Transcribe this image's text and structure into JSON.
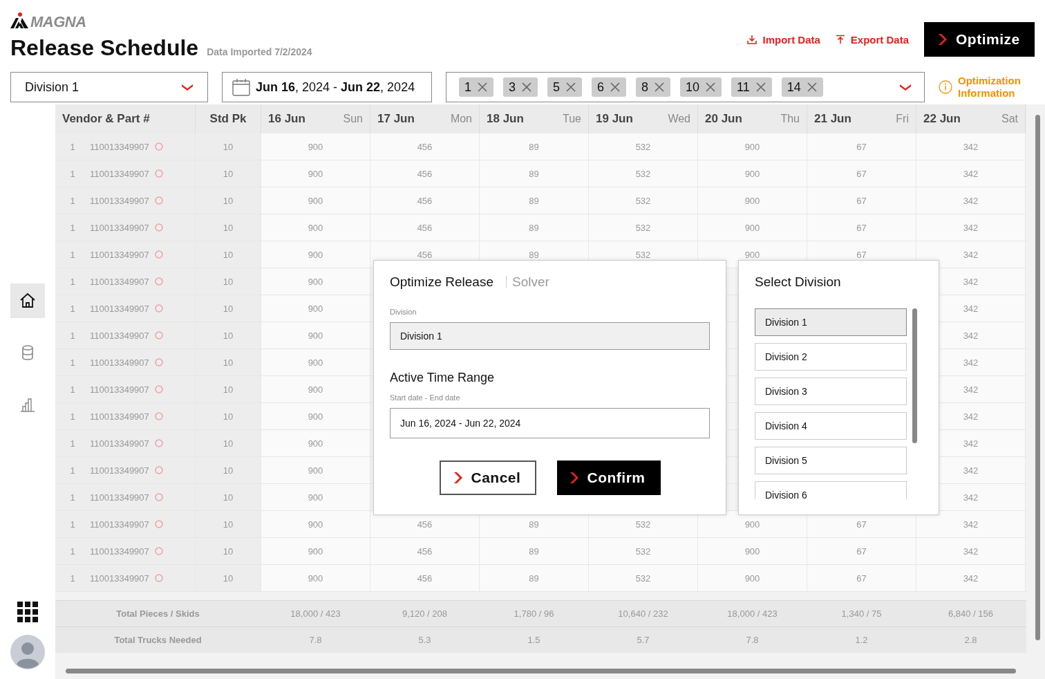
{
  "header": {
    "brand": "MAGNA",
    "title": "Release Schedule",
    "subtitle": "Data Imported 7/2/2024",
    "actions": [
      {
        "kind": "import",
        "label": "Import Data"
      },
      {
        "kind": "export",
        "label": "Export Data"
      }
    ],
    "primary_button": "Optimize"
  },
  "filters": {
    "division": "Division 1",
    "date_range": "**Jun 16**, 2024 - **Jun 22**, 2024",
    "chips": [
      "1",
      "3",
      "5",
      "6",
      "8",
      "10",
      "11",
      "14"
    ],
    "info": "Optimization Information"
  },
  "sidebar": {
    "items": [
      {
        "kind": "home",
        "selected": true
      },
      {
        "kind": "database",
        "selected": false
      },
      {
        "kind": "chart",
        "selected": false
      }
    ]
  },
  "table": {
    "columns": [
      {
        "label": "Vendor & Part #"
      },
      {
        "label": "Std Pk"
      },
      {
        "label": "16 Jun",
        "day": "Sun"
      },
      {
        "label": "17 Jun",
        "day": "Mon"
      },
      {
        "label": "18 Jun",
        "day": "Tue"
      },
      {
        "label": "19 Jun",
        "day": "Wed"
      },
      {
        "label": "20 Jun",
        "day": "Thu"
      },
      {
        "label": "21 Jun",
        "day": "Fri"
      },
      {
        "label": "22 Jun",
        "day": "Sat"
      }
    ],
    "rows": [
      {
        "vendor": "1",
        "part": "110013349907",
        "std_pk": "10",
        "values": [
          "900",
          "456",
          "89",
          "532",
          "900",
          "67",
          "342"
        ]
      },
      {
        "vendor": "1",
        "part": "110013349907",
        "std_pk": "10",
        "values": [
          "900",
          "456",
          "89",
          "532",
          "900",
          "67",
          "342"
        ]
      },
      {
        "vendor": "1",
        "part": "110013349907",
        "std_pk": "10",
        "values": [
          "900",
          "456",
          "89",
          "532",
          "900",
          "67",
          "342"
        ]
      },
      {
        "vendor": "1",
        "part": "110013349907",
        "std_pk": "10",
        "values": [
          "900",
          "456",
          "89",
          "532",
          "900",
          "67",
          "342"
        ]
      },
      {
        "vendor": "1",
        "part": "110013349907",
        "std_pk": "10",
        "values": [
          "900",
          "456",
          "89",
          "532",
          "900",
          "67",
          "342"
        ]
      },
      {
        "kind": "partial",
        "vendor": "1",
        "part": "110013349907",
        "std_pk": "10",
        "values": [
          "900",
          "342"
        ]
      },
      {
        "kind": "partial",
        "vendor": "1",
        "part": "110013349907",
        "std_pk": "10",
        "values": [
          "900",
          "342"
        ]
      },
      {
        "kind": "partial",
        "vendor": "1",
        "part": "110013349907",
        "std_pk": "10",
        "values": [
          "900",
          "342"
        ]
      },
      {
        "kind": "partial",
        "vendor": "1",
        "part": "110013349907",
        "std_pk": "10",
        "values": [
          "900",
          "342"
        ]
      },
      {
        "kind": "partial",
        "vendor": "1",
        "part": "110013349907",
        "std_pk": "10",
        "values": [
          "900",
          "342"
        ]
      },
      {
        "kind": "partial",
        "vendor": "1",
        "part": "110013349907",
        "std_pk": "10",
        "values": [
          "900",
          "342"
        ]
      },
      {
        "kind": "partial",
        "vendor": "1",
        "part": "110013349907",
        "std_pk": "10",
        "values": [
          "900",
          "342"
        ]
      },
      {
        "kind": "partial",
        "vendor": "1",
        "part": "110013349907",
        "std_pk": "10",
        "values": [
          "900",
          "342"
        ]
      },
      {
        "kind": "partial",
        "vendor": "1",
        "part": "110013349907",
        "std_pk": "10",
        "values": [
          "900",
          "342"
        ]
      },
      {
        "vendor": "1",
        "part": "110013349907",
        "std_pk": "10",
        "values": [
          "900",
          "456",
          "89",
          "532",
          "900",
          "67",
          "342"
        ]
      },
      {
        "vendor": "1",
        "part": "110013349907",
        "std_pk": "10",
        "values": [
          "900",
          "456",
          "89",
          "532",
          "900",
          "67",
          "342"
        ]
      },
      {
        "vendor": "1",
        "part": "110013349907",
        "std_pk": "10",
        "values": [
          "900",
          "456",
          "89",
          "532",
          "900",
          "67",
          "342"
        ]
      }
    ],
    "totals": [
      {
        "label": "Total Pieces / Skids",
        "values": [
          "18,000 / 423",
          "9,120 / 208",
          "1,780 / 96",
          "10,640 / 232",
          "18,000 / 423",
          "1,340 / 75",
          "6,840 / 156"
        ]
      },
      {
        "label": "Total Trucks Needed",
        "values": [
          "7.8",
          "5.3",
          "1.5",
          "5.7",
          "7.8",
          "1.2",
          "2.8"
        ]
      }
    ]
  },
  "optimize_dialog": {
    "title": "Optimize Release",
    "subtitle": "Solver",
    "division_label": "Division",
    "division_value": "Division 1",
    "section_title": "Active Time Range",
    "range_label": "Start date - End date",
    "range_value": "Jun 16, 2024 - Jun 22, 2024",
    "buttons": [
      {
        "kind": "secondary",
        "label": "Cancel"
      },
      {
        "kind": "primary",
        "label": "Confirm"
      }
    ]
  },
  "division_dialog": {
    "title": "Select Division",
    "items": [
      {
        "label": "Division 1",
        "selected": true
      },
      {
        "label": "Division 2",
        "selected": false
      },
      {
        "label": "Division 3",
        "selected": false
      },
      {
        "label": "Division 4",
        "selected": false
      },
      {
        "label": "Division 5",
        "selected": false
      },
      {
        "label": "Division 6",
        "selected": false
      }
    ]
  }
}
